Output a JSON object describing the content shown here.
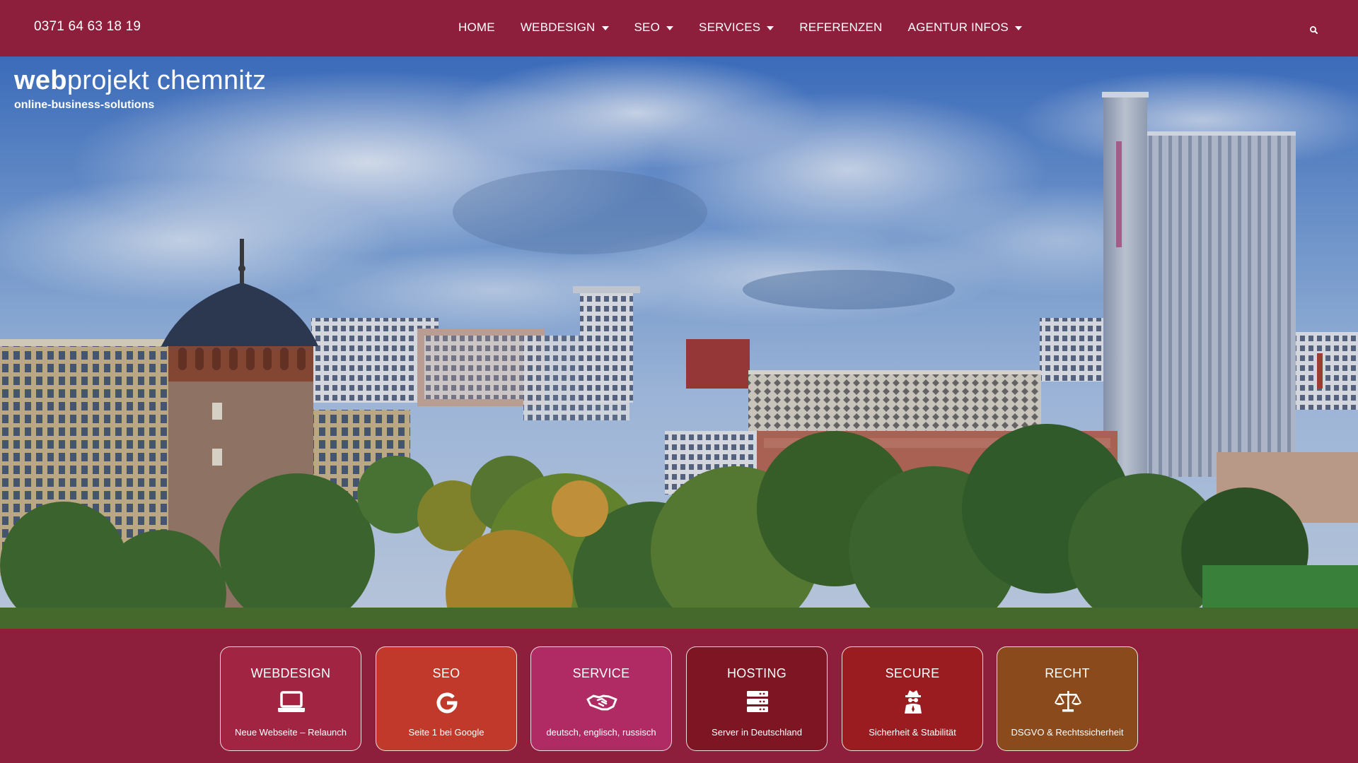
{
  "header": {
    "phone": "0371 64 63 18 19",
    "nav": [
      {
        "label": "HOME",
        "dropdown": false
      },
      {
        "label": "WEBDESIGN",
        "dropdown": true
      },
      {
        "label": "SEO",
        "dropdown": true
      },
      {
        "label": "SERVICES",
        "dropdown": true
      },
      {
        "label": "REFERENZEN",
        "dropdown": false
      },
      {
        "label": "AGENTUR INFOS",
        "dropdown": true
      }
    ],
    "search_icon": "search-icon"
  },
  "hero": {
    "brand_bold": "web",
    "brand_rest": "projekt chemnitz",
    "tagline": "online-business-solutions"
  },
  "cards": [
    {
      "title": "WEBDESIGN",
      "subtitle": "Neue Webseite – Relaunch",
      "icon": "laptop-icon",
      "color": "#a12443"
    },
    {
      "title": "SEO",
      "subtitle": "Seite 1 bei Google",
      "icon": "google-icon",
      "color": "#c0392b"
    },
    {
      "title": "SERVICE",
      "subtitle": "deutsch, englisch, russisch",
      "icon": "handshake-icon",
      "color": "#b02a63"
    },
    {
      "title": "HOSTING",
      "subtitle": "Server in Deutschland",
      "icon": "server-icon",
      "color": "#7d1522"
    },
    {
      "title": "SECURE",
      "subtitle": "Sicherheit & Stabilität",
      "icon": "spy-icon",
      "color": "#9b1c20"
    },
    {
      "title": "RECHT",
      "subtitle": "DSGVO & Rechtssicherheit",
      "icon": "scale-icon",
      "color": "#8a4a1c"
    }
  ],
  "colors": {
    "brand": "#8e1f3c"
  }
}
